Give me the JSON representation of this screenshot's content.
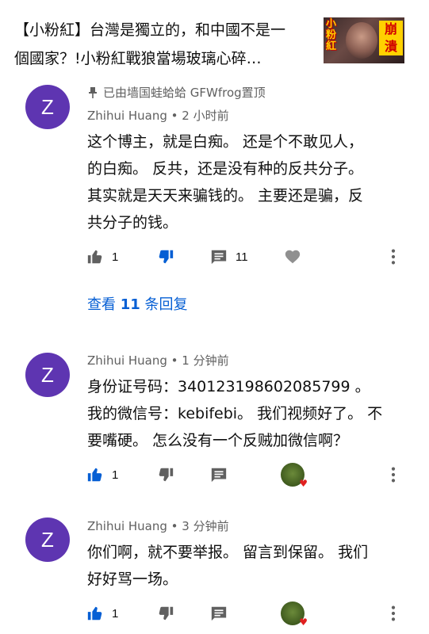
{
  "video": {
    "title": "【小粉紅】台灣是獨立的，和中國不是一個國家？!小粉紅戰狼當場玻璃心碎…",
    "thumbnail_text_left": "小粉紅",
    "thumbnail_text_right": "崩潰"
  },
  "comments": [
    {
      "pinned_text": "已由墙国蛙蛤蛤 GFWfrog置顶",
      "avatar_letter": "Z",
      "meta": "Zhihui Huang • 2 小时前",
      "lines": [
        "这个博主，就是白痴。 还是个不敢见人，",
        "的白痴。 反共，还是没有种的反共分子。",
        "其实就是天天来骗钱的。 主要还是骗，反",
        "共分子的钱。"
      ],
      "like_count": "1",
      "reply_count": "11",
      "replies_prefix": "查看 ",
      "replies_count": "11",
      "replies_suffix": " 条回复"
    },
    {
      "avatar_letter": "Z",
      "meta": "Zhihui Huang • 1 分钟前",
      "lines": [
        "身份证号码：340123198602085799 。",
        "我的微信号：kebifebi。 我们视频好了。 不",
        "要嘴硬。 怎么没有一个反贼加微信啊？"
      ],
      "like_count": "1"
    },
    {
      "avatar_letter": "Z",
      "meta": "Zhihui Huang • 3 分钟前",
      "lines": [
        "你们啊，就不要举报。 留言到保留。 我们",
        "好好骂一场。"
      ],
      "like_count": "1"
    }
  ],
  "colors": {
    "avatar": "#5e35b1",
    "link": "#065fd4",
    "icon": "#606060",
    "like_active": "#065fd4"
  },
  "icons": [
    "pin-icon",
    "thumbs-up-icon",
    "thumbs-down-icon",
    "comment-icon",
    "heart-icon",
    "more-vert-icon",
    "creator-heart-icon"
  ]
}
